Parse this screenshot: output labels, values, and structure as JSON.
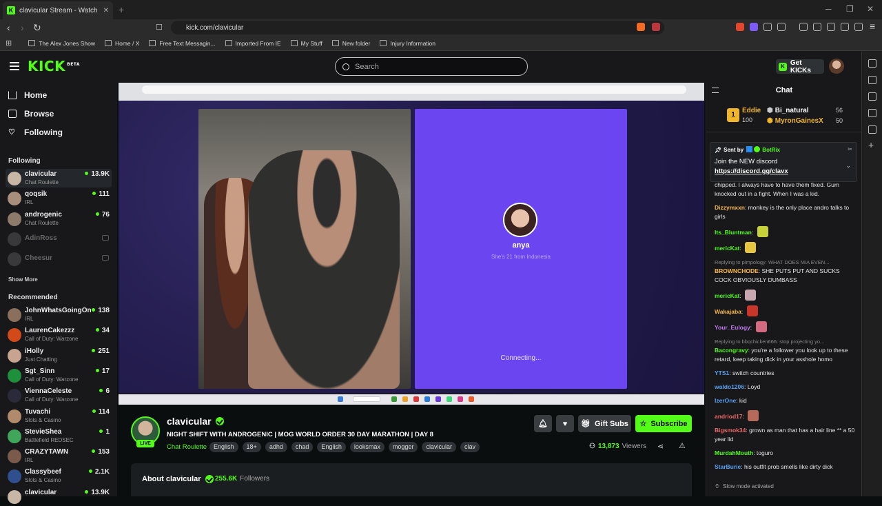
{
  "browser": {
    "tab_title": "clavicular Stream - Watch Liv…",
    "url": "kick.com/clavicular",
    "bookmarks": [
      "The Alex Jones Show",
      "Home / X",
      "Free Text Messagin...",
      "Imported From IE",
      "My Stuff",
      "New folder",
      "Injury Information"
    ]
  },
  "header": {
    "logo": "KICK",
    "logo_badge": "BETA",
    "search_placeholder": "Search",
    "get_kicks": "Get KICKs"
  },
  "sidebar": {
    "nav": [
      {
        "label": "Home",
        "icon": "home-icon"
      },
      {
        "label": "Browse",
        "icon": "compass-icon"
      },
      {
        "label": "Following",
        "icon": "heart-icon"
      }
    ],
    "following_heading": "Following",
    "following": [
      {
        "name": "clavicular",
        "category": "Chat Roulette",
        "viewers": "13.9K",
        "color": "#c9b7a6"
      },
      {
        "name": "qoqsik",
        "category": "IRL",
        "viewers": "111",
        "color": "#a98e7b"
      },
      {
        "name": "androgenic",
        "category": "Chat Roulette",
        "viewers": "76",
        "color": "#8c7a6b"
      },
      {
        "name": "AdinRoss",
        "category": "",
        "viewers": "",
        "color": "#777"
      },
      {
        "name": "Cheesur",
        "category": "",
        "viewers": "",
        "color": "#777"
      }
    ],
    "show_more": "Show More",
    "recommended_heading": "Recommended",
    "recommended": [
      {
        "name": "JohnWhatsGoingOn",
        "category": "IRL",
        "viewers": "138",
        "color": "#8a6f5c"
      },
      {
        "name": "LaurenCakezzz",
        "category": "Call of Duty: Warzone",
        "viewers": "34",
        "color": "#d24a1a"
      },
      {
        "name": "iHolly",
        "category": "Just Chatting",
        "viewers": "251",
        "color": "#c7a48f"
      },
      {
        "name": "Sgt_Sinn",
        "category": "Call of Duty: Warzone",
        "viewers": "17",
        "color": "#1e8f3a"
      },
      {
        "name": "ViennaCeleste",
        "category": "Call of Duty: Warzone",
        "viewers": "6",
        "color": "#2a2a3a"
      },
      {
        "name": "Tuvachi",
        "category": "Slots & Casino",
        "viewers": "114",
        "color": "#b08a6a"
      },
      {
        "name": "StevieShea",
        "category": "Battlefield REDSEC",
        "viewers": "1",
        "color": "#3fa65a"
      },
      {
        "name": "CRAZYTAWN",
        "category": "IRL",
        "viewers": "153",
        "color": "#7a5a4a"
      },
      {
        "name": "Classybeef",
        "category": "Slots & Casino",
        "viewers": "2.1K",
        "color": "#2f4f8f"
      },
      {
        "name": "clavicular",
        "category": "",
        "viewers": "13.9K",
        "color": "#c9b7a6"
      }
    ]
  },
  "video": {
    "stranger_name": "anya",
    "stranger_info": "She's 21 from Indonesia",
    "status": "Connecting..."
  },
  "stream": {
    "streamer": "clavicular",
    "live": "LIVE",
    "title": "NIGHT SHIFT WITH ANDROGENIC | MOG WORLD ORDER 30 DAY MARATHON | DAY 8",
    "category": "Chat Roulette",
    "tags": [
      "English",
      "18+",
      "adhd",
      "chad",
      "English",
      "looksmax",
      "mogger",
      "clavicular",
      "clav"
    ],
    "gift_subs": "Gift Subs",
    "subscribe": "Subscribe",
    "viewers": "13,873",
    "viewers_label": "Viewers",
    "about_title": "About clavicular",
    "followers": "255.6K",
    "followers_label": "Followers"
  },
  "chat": {
    "title": "Chat",
    "leaderboard": [
      {
        "name": "Eddie",
        "score": "100",
        "rank": "1"
      },
      {
        "name": "Bi_natural",
        "score": "56"
      },
      {
        "name": "MyronGainesX",
        "score": "50"
      }
    ],
    "pinned": {
      "sent_by_label": "Sent by",
      "sender": "BotRix",
      "text": "Join the NEW discord",
      "link": "https://discord.gg/clavx"
    },
    "messages": [
      {
        "user": "",
        "color": "#e6e6e6",
        "reply": "",
        "text": "chipped. I always have to have them fixed. Gum knocked out in a fight. When I was a kid."
      },
      {
        "user": "Dizzymxxn",
        "color": "#f7b844",
        "reply": "",
        "text": "monkey is the only place andro talks to girls"
      },
      {
        "user": "Its_Bluntman",
        "color": "#53fc18",
        "reply": "",
        "text": "",
        "emote": "#c7d23a"
      },
      {
        "user": "mericKat",
        "color": "#53fc18",
        "reply": "",
        "text": "",
        "emote": "#e6c640"
      },
      {
        "user": "BROWNCHODE",
        "color": "#f7b844",
        "reply": "Replying to pimpology: WHAT DOES MIA EVEN...",
        "text": "SHE PUTS PUT AND SUCKS COCK OBVIOUSLY DUMBASS"
      },
      {
        "user": "mericKat",
        "color": "#53fc18",
        "reply": "",
        "text": "",
        "emote": "#c8a8b0"
      },
      {
        "user": "Wakajaba",
        "color": "#f7b844",
        "reply": "",
        "text": "",
        "emote": "#c8352a"
      },
      {
        "user": "Your_Eulogy",
        "color": "#c07cf0",
        "reply": "",
        "text": "",
        "emote": "#d36a80"
      },
      {
        "user": "Bacongravy",
        "color": "#53fc18",
        "reply": "Replying to bbqchicken666: stop projecting yo...",
        "text": "you're a follower you look up to these retard, keep taking dick in your asshole homo"
      },
      {
        "user": "YTS1",
        "color": "#5aa0f0",
        "reply": "",
        "text": "switch countries"
      },
      {
        "user": "waldo1206",
        "color": "#5aa0f0",
        "reply": "",
        "text": "Loyd"
      },
      {
        "user": "IzerOne",
        "color": "#5aa0f0",
        "reply": "",
        "text": "kid"
      },
      {
        "user": "andriod17",
        "color": "#ef6a6a",
        "reply": "",
        "text": "",
        "emote": "#b86a5a"
      },
      {
        "user": "Bigsmok34",
        "color": "#ef6a6a",
        "reply": "",
        "text": "grown as man that has a hair line ** a 50 year lid"
      },
      {
        "user": "MurdahMouth",
        "color": "#53fc18",
        "reply": "",
        "text": "toguro"
      },
      {
        "user": "StarBurie",
        "color": "#5aa0f0",
        "reply": "",
        "text": "his outfit prob smells like dirty dick"
      }
    ],
    "slow_mode": "Slow mode activated"
  }
}
